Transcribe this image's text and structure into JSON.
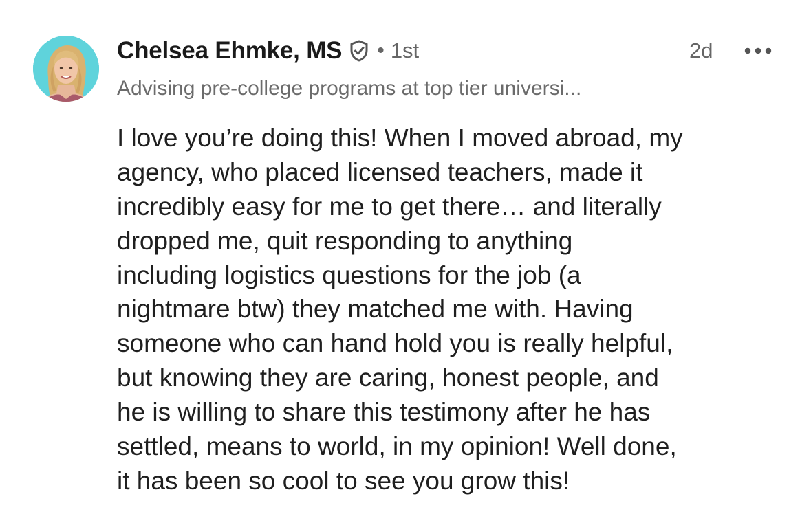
{
  "comment": {
    "author": {
      "name": "Chelsea Ehmke, MS",
      "verified_icon": "shield-check-icon",
      "separator": "•",
      "connection_degree": "1st",
      "headline": "Advising pre-college programs at top tier universi..."
    },
    "timestamp": "2d",
    "more_icon": "more-horizontal-icon",
    "body_lines": [
      "I love you’re doing this! When I moved abroad, my",
      "agency, who placed licensed teachers, made it",
      "incredibly easy for me to get there… and literally",
      "dropped me, quit responding to anything",
      "including logistics questions for the job (a",
      "nightmare btw) they matched me with. Having",
      "someone who can hand hold you is really helpful,",
      "but knowing they are caring, honest people, and",
      "he is willing to share this testimony after he has",
      "settled, means to world, in my opinion! Well done,",
      "it has been so cool to see you grow this!"
    ]
  },
  "colors": {
    "avatar_background": "#5fd3db",
    "text_primary": "#1f1f1f",
    "text_secondary": "#666666"
  }
}
